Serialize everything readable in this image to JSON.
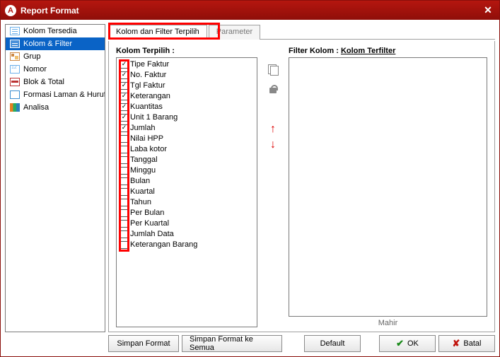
{
  "window": {
    "title": "Report Format"
  },
  "sidebar": {
    "items": [
      {
        "label": "Kolom Tersedia"
      },
      {
        "label": "Kolom & Filter"
      },
      {
        "label": "Grup"
      },
      {
        "label": "Nomor"
      },
      {
        "label": "Blok & Total"
      },
      {
        "label": "Formasi Laman & Huruf"
      },
      {
        "label": "Analisa"
      }
    ]
  },
  "tabs": {
    "selected": "Kolom dan Filter Terpilih",
    "other": "Parameter"
  },
  "kolom": {
    "title": "Kolom Terpilih :",
    "items": [
      {
        "label": "Tipe Faktur",
        "checked": true
      },
      {
        "label": "No. Faktur",
        "checked": true
      },
      {
        "label": "Tgl Faktur",
        "checked": true
      },
      {
        "label": "Keterangan",
        "checked": true
      },
      {
        "label": "Kuantitas",
        "checked": true
      },
      {
        "label": "Unit 1 Barang",
        "checked": true
      },
      {
        "label": "Jumlah",
        "checked": true
      },
      {
        "label": "Nilai HPP",
        "checked": false
      },
      {
        "label": "Laba kotor",
        "checked": false
      },
      {
        "label": "Tanggal",
        "checked": false
      },
      {
        "label": "Minggu",
        "checked": false
      },
      {
        "label": "Bulan",
        "checked": false
      },
      {
        "label": "Kuartal",
        "checked": false
      },
      {
        "label": "Tahun",
        "checked": false
      },
      {
        "label": "Per Bulan",
        "checked": false
      },
      {
        "label": "Per Kuartal",
        "checked": false
      },
      {
        "label": "Jumlah Data",
        "checked": false
      },
      {
        "label": "Keterangan Barang",
        "checked": false
      }
    ]
  },
  "filter": {
    "title_prefix": "Filter Kolom :  ",
    "title_link": "Kolom Terfilter"
  },
  "advanced_label": "Mahir",
  "buttons": {
    "simpan": "Simpan Format",
    "simpan_semua": "Simpan Format ke Semua",
    "default": "Default",
    "ok": "OK",
    "batal": "Batal"
  }
}
